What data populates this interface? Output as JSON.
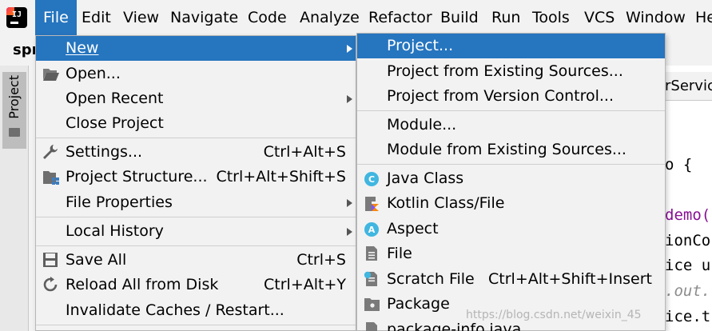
{
  "menubar": {
    "items": [
      {
        "label": "File"
      },
      {
        "label": "Edit"
      },
      {
        "label": "View"
      },
      {
        "label": "Navigate"
      },
      {
        "label": "Code"
      },
      {
        "label": "Analyze"
      },
      {
        "label": "Refactor"
      },
      {
        "label": "Build"
      },
      {
        "label": "Run"
      },
      {
        "label": "Tools"
      },
      {
        "label": "VCS"
      },
      {
        "label": "Window"
      },
      {
        "label": "He"
      }
    ],
    "accent_color": "#2675bf"
  },
  "logo": {
    "text": "IJ"
  },
  "toolbar": {
    "project_name": "spr"
  },
  "project_tool": {
    "label": "Project"
  },
  "editor": {
    "tab_label": "rService",
    "lines": [
      "o {",
      "demo(",
      "ionCo",
      "ice u",
      ".out.",
      "ice.t"
    ]
  },
  "file_menu": {
    "items": [
      {
        "label": "New",
        "icon": "none",
        "submenu": true
      },
      {
        "label": "Open...",
        "icon": "folder-open-icon"
      },
      {
        "label": "Open Recent",
        "submenu": true
      },
      {
        "label": "Close Project"
      },
      {
        "label": "Settings...",
        "icon": "wrench-icon",
        "shortcut": "Ctrl+Alt+S"
      },
      {
        "label": "Project Structure...",
        "icon": "project-structure-icon",
        "shortcut": "Ctrl+Alt+Shift+S"
      },
      {
        "label": "File Properties",
        "submenu": true
      },
      {
        "label": "Local History",
        "submenu": true
      },
      {
        "label": "Save All",
        "icon": "save-icon",
        "shortcut": "Ctrl+S"
      },
      {
        "label": "Reload All from Disk",
        "icon": "reload-icon",
        "shortcut": "Ctrl+Alt+Y"
      },
      {
        "label": "Invalidate Caches / Restart..."
      }
    ]
  },
  "new_menu": {
    "items": [
      {
        "label": "Project..."
      },
      {
        "label": "Project from Existing Sources..."
      },
      {
        "label": "Project from Version Control..."
      },
      {
        "label": "Module..."
      },
      {
        "label": "Module from Existing Sources..."
      },
      {
        "label": "Java Class",
        "icon": "java-class-icon"
      },
      {
        "label": "Kotlin Class/File",
        "icon": "kotlin-icon"
      },
      {
        "label": "Aspect",
        "icon": "aspect-icon"
      },
      {
        "label": "File",
        "icon": "file-icon"
      },
      {
        "label": "Scratch File",
        "icon": "scratch-file-icon",
        "shortcut": "Ctrl+Alt+Shift+Insert"
      },
      {
        "label": "Package",
        "icon": "package-icon"
      },
      {
        "label": "package-info.java",
        "icon": "package-info-icon"
      }
    ]
  },
  "watermark": {
    "text": "https://blog.csdn.net/weixin_45"
  }
}
